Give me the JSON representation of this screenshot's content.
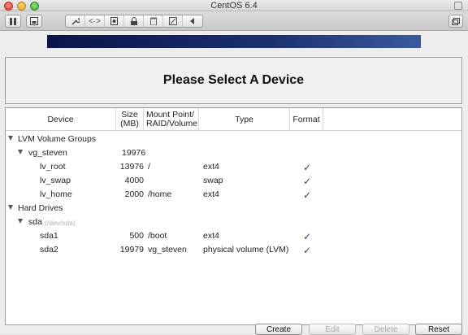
{
  "window": {
    "title": "CentOS 6.4"
  },
  "toolbar": {
    "segment_icons": [
      "wrench-icon",
      "network-arrows-icon",
      "disk-icon",
      "lock-icon",
      "trash-icon",
      "edit-icon",
      "arrow-left-icon"
    ],
    "network_label": "<·>"
  },
  "header": {
    "title": "Please Select A Device"
  },
  "table": {
    "columns": {
      "device": "Device",
      "size_line1": "Size",
      "size_line2": "(MB)",
      "mount_line1": "Mount Point/",
      "mount_line2": "RAID/Volume",
      "type": "Type",
      "format": "Format"
    },
    "rows": [
      {
        "device": "LVM Volume Groups",
        "size": "",
        "mount": "",
        "type": "",
        "format": ""
      },
      {
        "device": "vg_steven",
        "size": "19976",
        "mount": "",
        "type": "",
        "format": ""
      },
      {
        "device": "lv_root",
        "size": "13976",
        "mount": "/",
        "type": "ext4",
        "format": "✓"
      },
      {
        "device": "lv_swap",
        "size": "4000",
        "mount": "",
        "type": "swap",
        "format": "✓"
      },
      {
        "device": "lv_home",
        "size": "2000",
        "mount": "/home",
        "type": "ext4",
        "format": "✓"
      },
      {
        "device": "Hard Drives",
        "size": "",
        "mount": "",
        "type": "",
        "format": ""
      },
      {
        "device": "sda",
        "device_sub": "(/dev/sda)",
        "size": "",
        "mount": "",
        "type": "",
        "format": ""
      },
      {
        "device": "sda1",
        "size": "500",
        "mount": "/boot",
        "type": "ext4",
        "format": "✓"
      },
      {
        "device": "sda2",
        "size": "19979",
        "mount": "vg_steven",
        "type": "physical volume (LVM)",
        "format": "✓"
      }
    ]
  },
  "buttons": {
    "create": "Create",
    "edit": "Edit",
    "delete": "Delete",
    "reset": "Reset"
  }
}
